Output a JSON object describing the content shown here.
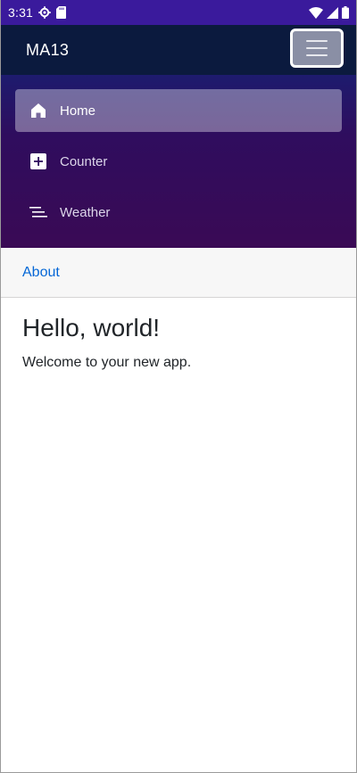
{
  "status_bar": {
    "time": "3:31",
    "background": "#3a1a9c"
  },
  "app_bar": {
    "title": "MA13",
    "background": "#0b1a3e"
  },
  "nav": {
    "items": [
      {
        "label": "Home",
        "icon": "home-icon",
        "active": true
      },
      {
        "label": "Counter",
        "icon": "plus-icon",
        "active": false
      },
      {
        "label": "Weather",
        "icon": "list-icon",
        "active": false
      }
    ]
  },
  "top_row": {
    "about_label": "About",
    "link_color": "#0366d6"
  },
  "main": {
    "heading": "Hello, world!",
    "text": "Welcome to your new app."
  }
}
